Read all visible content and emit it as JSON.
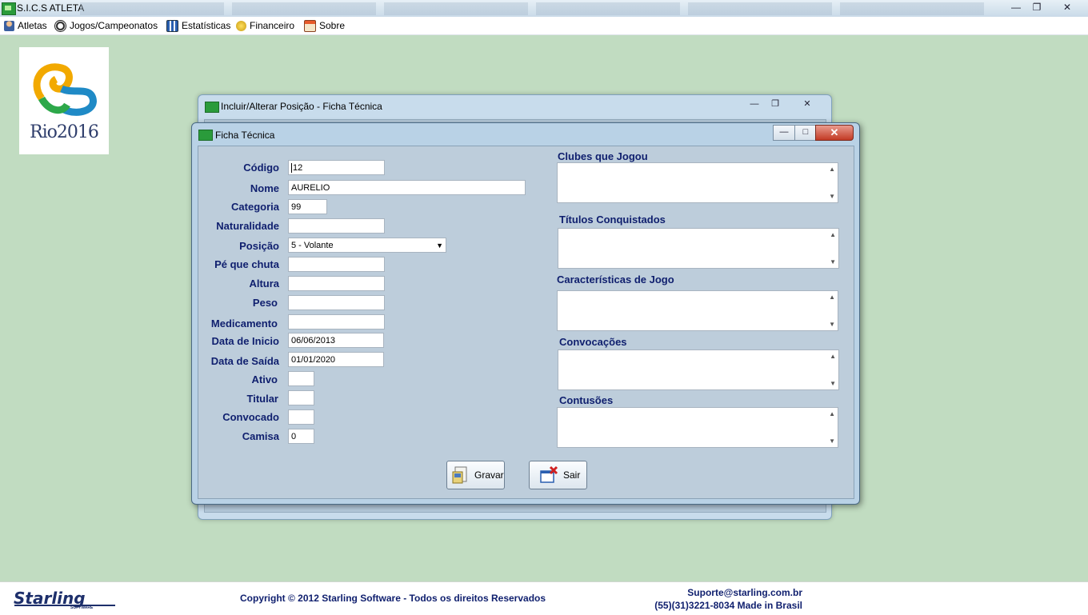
{
  "window": {
    "title": "S.I.C.S ATLETA"
  },
  "menu": [
    {
      "label": "Atletas",
      "icon": "person-icon"
    },
    {
      "label": "Jogos/Campeonatos",
      "icon": "soccer-ball-icon"
    },
    {
      "label": "Estatísticas",
      "icon": "chart-icon"
    },
    {
      "label": "Financeiro",
      "icon": "coins-icon"
    },
    {
      "label": "Sobre",
      "icon": "info-box-icon"
    }
  ],
  "logo": {
    "text": "Rio2016"
  },
  "back_window": {
    "title": "Incluir/Alterar Posição - Ficha Técnica"
  },
  "dialog": {
    "title": "Ficha Técnica",
    "fields": {
      "codigo": {
        "label": "Código",
        "value": "12"
      },
      "nome": {
        "label": "Nome",
        "value": "AURELIO"
      },
      "categoria": {
        "label": "Categoria",
        "value": "99"
      },
      "naturalidade": {
        "label": "Naturalidade",
        "value": ""
      },
      "posicao": {
        "label": "Posição",
        "value": "5 - Volante"
      },
      "pe_que_chuta": {
        "label": "Pé que chuta",
        "value": ""
      },
      "altura": {
        "label": "Altura",
        "value": ""
      },
      "peso": {
        "label": "Peso",
        "value": ""
      },
      "medicamento": {
        "label": "Medicamento",
        "value": ""
      },
      "data_inicio": {
        "label": "Data de Inicio",
        "value": "06/06/2013"
      },
      "data_saida": {
        "label": "Data de Saída",
        "value": "01/01/2020"
      },
      "ativo": {
        "label": "Ativo",
        "value": ""
      },
      "titular": {
        "label": "Titular",
        "value": ""
      },
      "convocado": {
        "label": "Convocado",
        "value": ""
      },
      "camisa": {
        "label": "Camisa",
        "value": "0"
      }
    },
    "memos": {
      "clubes": {
        "label": "Clubes que Jogou"
      },
      "titulos": {
        "label": "Títulos Conquistados"
      },
      "caracteristicas": {
        "label": "Características de Jogo"
      },
      "convocacoes": {
        "label": "Convocações"
      },
      "contusoes": {
        "label": "Contusões"
      }
    },
    "buttons": {
      "save": "Gravar",
      "exit": "Sair"
    }
  },
  "footer": {
    "logo": "Starling",
    "logo_sub": "SOFTWARE",
    "copyright": "Copyright © 2012 Starling Software - Todos os direitos Reservados",
    "email": "Suporte@starling.com.br",
    "phone": "(55)(31)3221-8034 Made in Brasil"
  }
}
